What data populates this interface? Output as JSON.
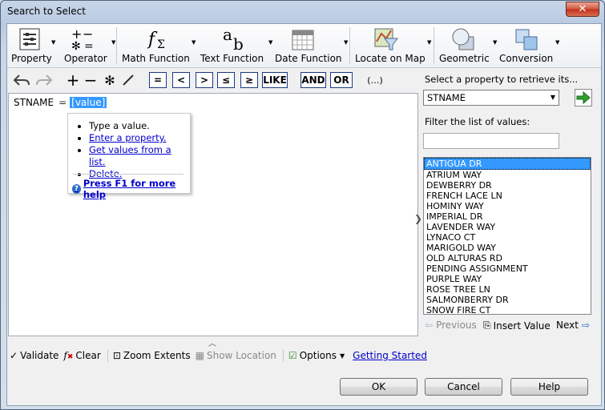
{
  "window": {
    "title": "Search to Select",
    "close_glyph": "✕"
  },
  "ribbon": {
    "property": "Property",
    "operator": "Operator",
    "math_function": "Math Function",
    "text_function": "Text Function",
    "date_function": "Date Function",
    "locate_on_map": "Locate on Map",
    "geometric": "Geometric",
    "conversion": "Conversion"
  },
  "operators": {
    "equals": "=",
    "less": "<",
    "greater": ">",
    "like": "LIKE",
    "and": "AND",
    "or": "OR",
    "paren": "(…)"
  },
  "editor": {
    "field": "STNAME",
    "operator": "=",
    "value": "[value]"
  },
  "tooltip": {
    "items": [
      "Type a value.",
      "Enter a property.",
      "Get values from a list.",
      "Delete."
    ],
    "help": "Press F1 for more help"
  },
  "bottom": {
    "validate": "Validate",
    "clear": "Clear",
    "zoom_extents": "Zoom Extents",
    "show_location": "Show Location",
    "options": "Options",
    "getting_started": "Getting Started"
  },
  "right": {
    "prompt": "Select a property to retrieve its...",
    "selected_property": "STNAME",
    "filter_label": "Filter the list of values:",
    "filter_value": "",
    "values": [
      "ANTIGUA DR",
      "ATRIUM WAY",
      "DEWBERRY DR",
      "FRENCH LACE LN",
      "HOMINY WAY",
      "IMPERIAL DR",
      "LAVENDER WAY",
      "LYNACO CT",
      "MARIGOLD WAY",
      "OLD ALTURAS RD",
      "PENDING ASSIGNMENT",
      "PURPLE WAY",
      "ROSE TREE LN",
      "SALMONBERRY DR",
      "SNOW FIRE CT"
    ],
    "selected_index": 0,
    "previous": "Previous",
    "insert_value": "Insert Value",
    "next": "Next"
  },
  "buttons": {
    "ok": "OK",
    "cancel": "Cancel",
    "help": "Help"
  }
}
